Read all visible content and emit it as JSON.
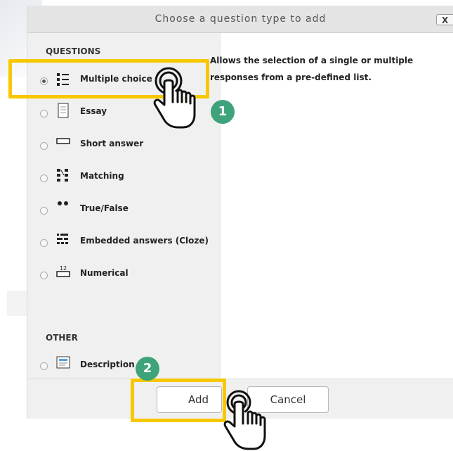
{
  "dialog": {
    "title": "Choose a question type to add",
    "close_label": "X"
  },
  "sections": {
    "questions_label": "QUESTIONS",
    "other_label": "OTHER"
  },
  "question_types": [
    {
      "label": "Multiple choice",
      "icon": "multiple-choice-icon",
      "selected": true
    },
    {
      "label": "Essay",
      "icon": "essay-icon",
      "selected": false
    },
    {
      "label": "Short answer",
      "icon": "short-answer-icon",
      "selected": false
    },
    {
      "label": "Matching",
      "icon": "matching-icon",
      "selected": false
    },
    {
      "label": "True/False",
      "icon": "true-false-icon",
      "selected": false
    },
    {
      "label": "Embedded answers (Cloze)",
      "icon": "cloze-icon",
      "selected": false
    },
    {
      "label": "Numerical",
      "icon": "numerical-icon",
      "selected": false
    }
  ],
  "other_types": [
    {
      "label": "Description",
      "icon": "description-icon",
      "selected": false
    }
  ],
  "description": {
    "line1": "Allows the selection of a single or multiple",
    "line2": "responses from a pre-defined list."
  },
  "buttons": {
    "add_label": "Add",
    "cancel_label": "Cancel"
  },
  "annotations": {
    "step1": "1",
    "step2": "2",
    "highlight_color": "#f7c800",
    "badge_color": "#3ea37a"
  }
}
